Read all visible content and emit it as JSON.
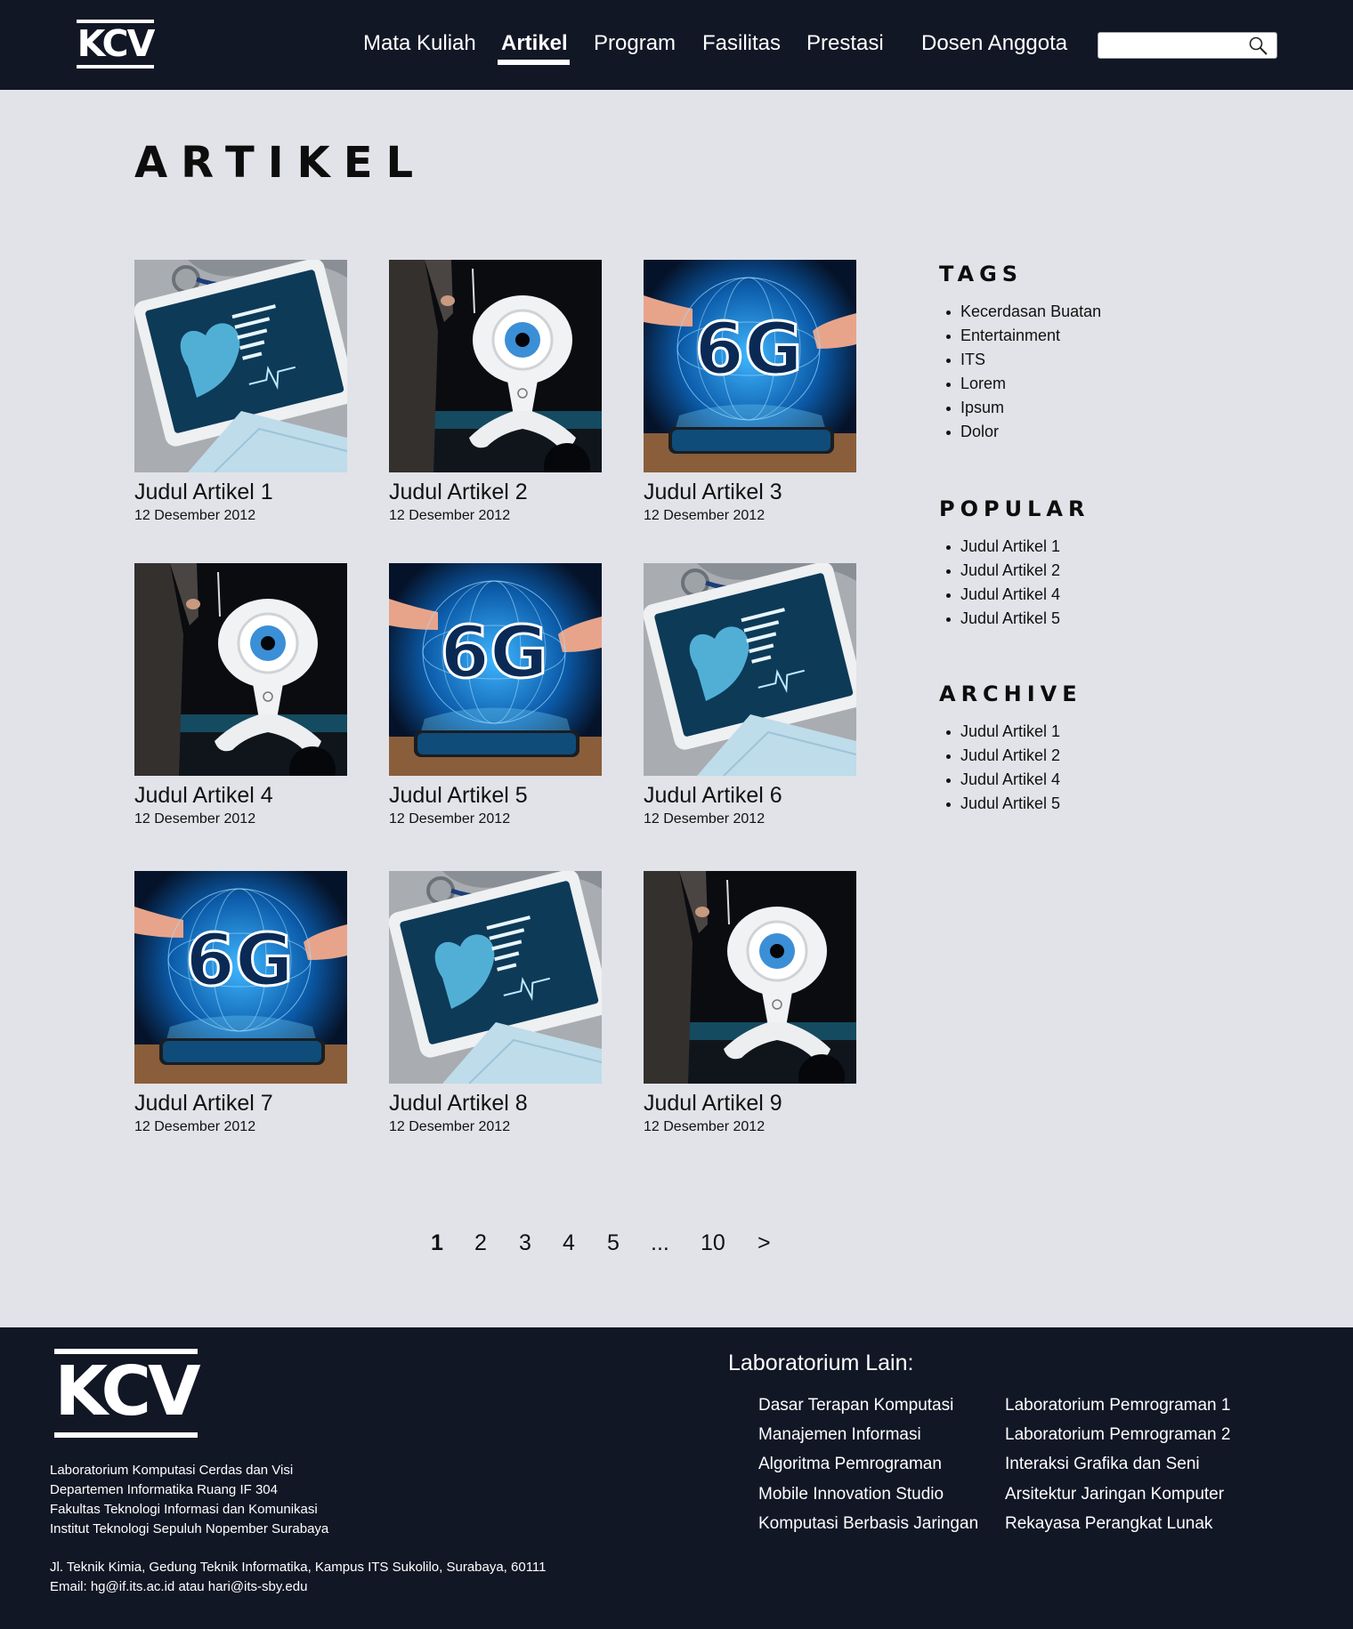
{
  "header": {
    "logo_text": "KCV",
    "nav": [
      {
        "label": "Mata Kuliah",
        "active": false
      },
      {
        "label": "Artikel",
        "active": true
      },
      {
        "label": "Program",
        "active": false
      },
      {
        "label": "Fasilitas",
        "active": false
      },
      {
        "label": "Prestasi",
        "active": false
      },
      {
        "label": "Dosen Anggota",
        "active": false
      }
    ],
    "search": {
      "value": "",
      "placeholder": ""
    },
    "search_icon": "search-icon"
  },
  "main": {
    "title": "ARTIKEL",
    "articles": [
      {
        "title": "Judul Artikel 1",
        "date": "12 Desember 2012",
        "image": "heart-tablet"
      },
      {
        "title": "Judul Artikel 2",
        "date": "12 Desember 2012",
        "image": "eye-robot"
      },
      {
        "title": "Judul Artikel 3",
        "date": "12 Desember 2012",
        "image": "6g-hologram"
      },
      {
        "title": "Judul Artikel 4",
        "date": "12 Desember 2012",
        "image": "eye-robot"
      },
      {
        "title": "Judul Artikel 5",
        "date": "12 Desember 2012",
        "image": "6g-hologram"
      },
      {
        "title": "Judul Artikel 6",
        "date": "12 Desember 2012",
        "image": "heart-tablet"
      },
      {
        "title": "Judul Artikel 7",
        "date": "12 Desember 2012",
        "image": "6g-hologram"
      },
      {
        "title": "Judul Artikel 8",
        "date": "12 Desember 2012",
        "image": "heart-tablet"
      },
      {
        "title": "Judul Artikel 9",
        "date": "12 Desember 2012",
        "image": "eye-robot"
      }
    ],
    "image_text_6g": "6G"
  },
  "sidebar": {
    "tags": {
      "heading": "TAGS",
      "items": [
        "Kecerdasan Buatan",
        "Entertainment",
        "ITS",
        "Lorem",
        "Ipsum",
        "Dolor"
      ]
    },
    "popular": {
      "heading": "POPULAR",
      "items": [
        "Judul Artikel 1",
        "Judul Artikel 2",
        "Judul Artikel 4",
        "Judul Artikel 5"
      ]
    },
    "archive": {
      "heading": "ARCHIVE",
      "items": [
        "Judul Artikel 1",
        "Judul Artikel 2",
        "Judul Artikel 4",
        "Judul Artikel 5"
      ]
    }
  },
  "pagination": {
    "pages": [
      "1",
      "2",
      "3",
      "4",
      "5",
      "...",
      "10"
    ],
    "current": "1",
    "next": ">"
  },
  "footer": {
    "logo_text": "KCV",
    "address_lines": [
      "Laboratorium Komputasi Cerdas dan Visi",
      "Departemen Informatika Ruang IF 304",
      "Fakultas Teknologi Informasi dan Komunikasi",
      "Institut Teknologi Sepuluh Nopember Surabaya"
    ],
    "street": "Jl. Teknik Kimia, Gedung Teknik Informatika, Kampus ITS Sukolilo, Surabaya, 60111",
    "email": "Email: hg@if.its.ac.id atau hari@its-sby.edu",
    "labs_title": "Laboratorium Lain:",
    "labs_col1": [
      "Dasar Terapan Komputasi",
      "Manajemen Informasi",
      "Algoritma Pemrograman",
      "Mobile Innovation Studio",
      "Komputasi Berbasis Jaringan"
    ],
    "labs_col2": [
      "Laboratorium Pemrograman 1",
      "Laboratorium Pemrograman 2",
      "Interaksi Grafika dan Seni",
      "Arsitektur Jaringan Komputer",
      "Rekayasa Perangkat Lunak"
    ]
  },
  "colors": {
    "header_bg": "#121726",
    "page_bg": "#e1e3e8",
    "text": "#111111",
    "footer_bg": "#121726"
  }
}
